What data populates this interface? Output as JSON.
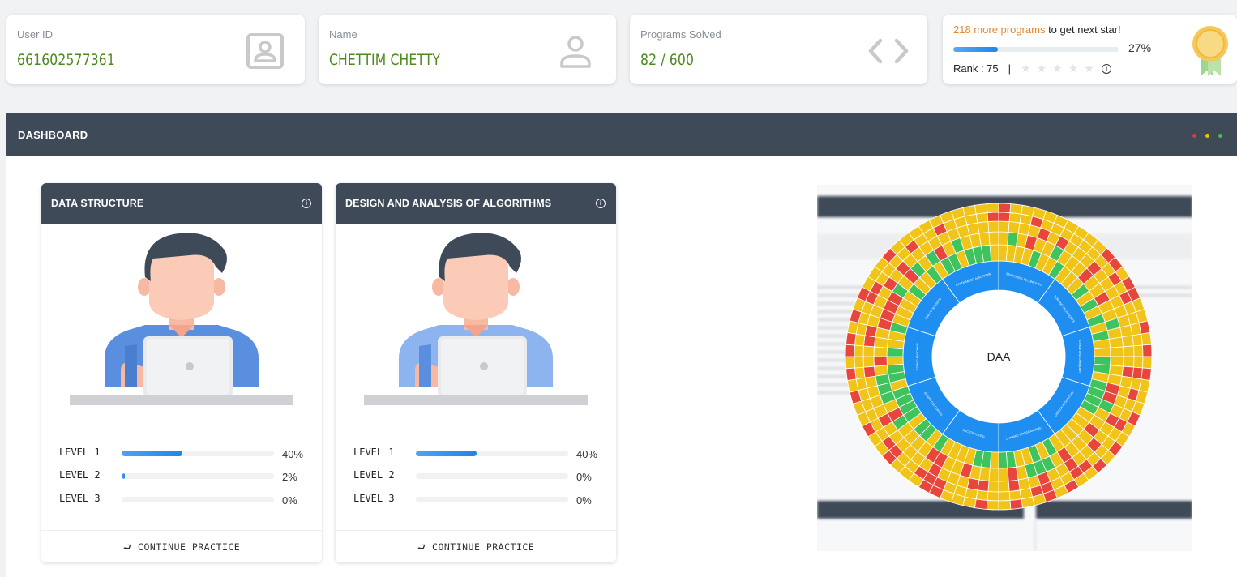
{
  "stats": {
    "user_id": {
      "label": "User ID",
      "value": "661602577361",
      "icon": "id-card-icon"
    },
    "name": {
      "label": "Name",
      "value": "CHETTIM CHETTY",
      "icon": "user-icon"
    },
    "programs": {
      "label": "Programs Solved",
      "value": "82 / 600",
      "icon": "code-icon"
    },
    "rank": {
      "more_count": "218 more programs",
      "more_suffix": " to get next star!",
      "progress": 27,
      "progress_label": "27%",
      "rank_label": "Rank : 75",
      "separator": "|",
      "stars_filled": 0,
      "stars_total": 5,
      "info_glyph": "i"
    }
  },
  "dashboard": {
    "title": "DASHBOARD",
    "window_dots": [
      "#e53935",
      "#f2c200",
      "#43c04a"
    ]
  },
  "courses": [
    {
      "title": "DATA STRUCTURE",
      "levels": [
        {
          "label": "LEVEL 1",
          "value": 40,
          "pct": "40%"
        },
        {
          "label": "LEVEL 2",
          "value": 2,
          "pct": "2%"
        },
        {
          "label": "LEVEL 3",
          "value": 0,
          "pct": "0%"
        }
      ],
      "action": "⮐ CONTINUE PRACTICE"
    },
    {
      "title": "DESIGN AND ANALYSIS OF ALGORITHMS",
      "levels": [
        {
          "label": "LEVEL 1",
          "value": 40,
          "pct": "40%"
        },
        {
          "label": "LEVEL 2",
          "value": 0,
          "pct": "0%"
        },
        {
          "label": "LEVEL 3",
          "value": 0,
          "pct": "0%"
        }
      ],
      "action": "⮐ CONTINUE PRACTICE"
    }
  ],
  "sunburst": {
    "center_label": "DAA",
    "topics": [
      "SEARCHING TECHNIQUES",
      "SORTING TECHNIQUES",
      "DIVIDE AND CONQUER",
      "GREEDY ALGORITHM",
      "DYNAMIC PROGRAMMING",
      "BACKTRACKING",
      "GRAPH COLOURING",
      "STRING MATCHING",
      "SUM OF SUBSETS",
      "RANDOMIZED ALGORITHM"
    ],
    "colors": {
      "topic": "#1e8ff0",
      "solved": "#3fc35c",
      "partial": "#f0c419",
      "failed": "#e8453c"
    }
  }
}
